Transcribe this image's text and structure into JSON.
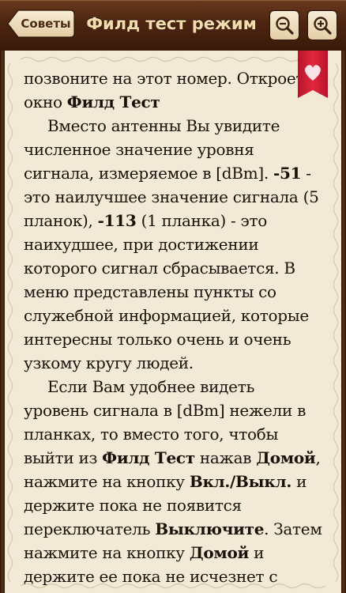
{
  "header": {
    "back_label": "Советы",
    "title": "Филд тест режим"
  },
  "content": {
    "lines": [
      {
        "indent": false,
        "parts": [
          {
            "t": "позвоните на этот номер. Откроется",
            "b": false
          }
        ]
      },
      {
        "indent": false,
        "parts": [
          {
            "t": "окно ",
            "b": false
          },
          {
            "t": "Филд Тест",
            "b": true
          }
        ]
      },
      {
        "indent": true,
        "parts": [
          {
            "t": "Вместо антенны Вы увидите",
            "b": false
          }
        ]
      },
      {
        "indent": false,
        "parts": [
          {
            "t": "численное значение уровня",
            "b": false
          }
        ]
      },
      {
        "indent": false,
        "parts": [
          {
            "t": "сигнала, измеряемое в [dBm]. ",
            "b": false
          },
          {
            "t": "-51",
            "b": true
          },
          {
            "t": " -",
            "b": false
          }
        ]
      },
      {
        "indent": false,
        "parts": [
          {
            "t": "это наилучшее значение сигнала (5",
            "b": false
          }
        ]
      },
      {
        "indent": false,
        "parts": [
          {
            "t": "планок), ",
            "b": false
          },
          {
            "t": "-113",
            "b": true
          },
          {
            "t": " (1 планка) - это",
            "b": false
          }
        ]
      },
      {
        "indent": false,
        "parts": [
          {
            "t": "наихудшее, при достижении",
            "b": false
          }
        ]
      },
      {
        "indent": false,
        "parts": [
          {
            "t": "которого сигнал сбрасывается. В",
            "b": false
          }
        ]
      },
      {
        "indent": false,
        "parts": [
          {
            "t": "меню представлены пункты со",
            "b": false
          }
        ]
      },
      {
        "indent": false,
        "parts": [
          {
            "t": "служебной информацией, которые",
            "b": false
          }
        ]
      },
      {
        "indent": false,
        "parts": [
          {
            "t": "интересны только очень и очень",
            "b": false
          }
        ]
      },
      {
        "indent": false,
        "parts": [
          {
            "t": "узкому кругу людей.",
            "b": false
          }
        ]
      },
      {
        "indent": true,
        "parts": [
          {
            "t": "Если Вам удобнее видеть",
            "b": false
          }
        ]
      },
      {
        "indent": false,
        "parts": [
          {
            "t": "уровень сигнала в [dBm] нежели в",
            "b": false
          }
        ]
      },
      {
        "indent": false,
        "parts": [
          {
            "t": "планках, то вместо того, чтобы",
            "b": false
          }
        ]
      },
      {
        "indent": false,
        "parts": [
          {
            "t": "выйти из ",
            "b": false
          },
          {
            "t": "Филд Тест",
            "b": true
          },
          {
            "t": " нажав ",
            "b": false
          },
          {
            "t": "Домой",
            "b": true
          },
          {
            "t": ",",
            "b": false
          }
        ]
      },
      {
        "indent": false,
        "parts": [
          {
            "t": "нажмите на кнопку ",
            "b": false
          },
          {
            "t": "Вкл./Выкл.",
            "b": true
          },
          {
            "t": " и",
            "b": false
          }
        ]
      },
      {
        "indent": false,
        "parts": [
          {
            "t": "держите пока не появится",
            "b": false
          }
        ]
      },
      {
        "indent": false,
        "parts": [
          {
            "t": "переключатель ",
            "b": false
          },
          {
            "t": "Выключите",
            "b": true
          },
          {
            "t": ". Затем",
            "b": false
          }
        ]
      },
      {
        "indent": false,
        "parts": [
          {
            "t": "нажмите на кнопку ",
            "b": false
          },
          {
            "t": "Домой",
            "b": true
          },
          {
            "t": " и",
            "b": false
          }
        ]
      },
      {
        "indent": false,
        "parts": [
          {
            "t": "держите ее пока не исчезнет с",
            "b": false
          }
        ]
      }
    ]
  },
  "icons": {
    "back": "back-arrow-button",
    "zoom_out": "zoom-out-icon",
    "zoom_in": "zoom-in-icon",
    "bookmark": "heart-bookmark-icon"
  },
  "colors": {
    "header": "#4c2510",
    "title": "#f3dcae",
    "page": "#f2ead6",
    "text": "#1a1208",
    "bookmark": "#d8203a"
  }
}
